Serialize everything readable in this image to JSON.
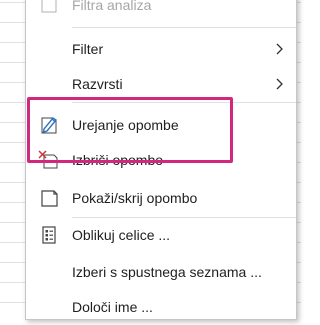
{
  "menu": {
    "items": [
      {
        "label": "Filtra analiza",
        "icon": "none",
        "disabled": true
      },
      {
        "label": "Filter",
        "icon": "none",
        "submenu": true
      },
      {
        "label": "Razvrsti",
        "icon": "none",
        "submenu": true
      },
      {
        "label": "Urejanje opombe",
        "icon": "edit-note-icon"
      },
      {
        "label": "Izbriši opombo",
        "icon": "delete-note-icon"
      },
      {
        "label": "Pokaži/skrij opombo",
        "icon": "show-hide-note-icon"
      },
      {
        "label": "Oblikuj celice ...",
        "icon": "format-cells-icon"
      },
      {
        "label": "Izberi s spustnega seznama ...",
        "icon": "none"
      },
      {
        "label": "Določi ime ...",
        "icon": "none"
      }
    ]
  },
  "highlight_color": "#d1287e",
  "icon_colors": {
    "blue": "#2b72c4",
    "red": "#d13438",
    "gray": "#444444"
  }
}
